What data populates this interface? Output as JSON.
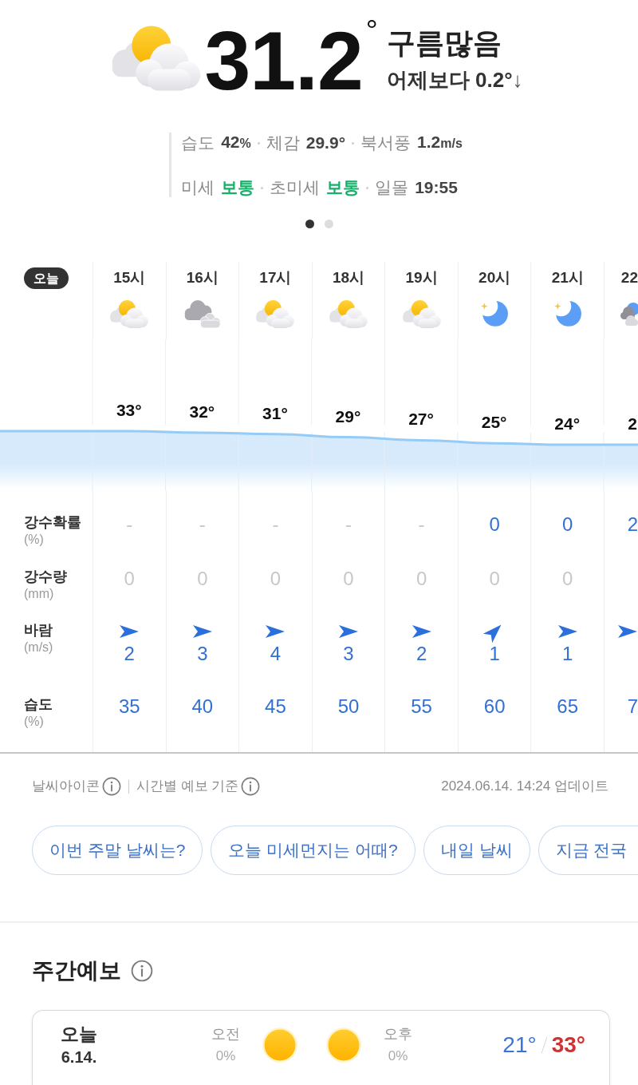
{
  "current": {
    "icon": {
      "kind": "partly_cloudy"
    },
    "temperature": "31.2$^{°}$",
    "condition": "구름많음",
    "yesterday_diff": "어제보다 0.2°",
    "trend_arrow": "↓",
    "details": [
      {
        "items": [
          {
            "label": "습도",
            "value": "42",
            "unit": "%",
            "color": "#444444"
          },
          {
            "label": "체감",
            "value": "29.9°",
            "color": "#444444"
          },
          {
            "label": "북서풍",
            "value": "1.2",
            "unit": "m/s",
            "color": "#444444"
          }
        ]
      },
      {
        "items": [
          {
            "label": "미세",
            "value": "보통",
            "color": "#17b06b"
          },
          {
            "label": "초미세",
            "value": "보통",
            "color": "#17b06b"
          },
          {
            "label": "일몰",
            "value": "19:55",
            "color": "#444444"
          }
        ]
      }
    ],
    "pages": [
      {
        "selected": true
      },
      {
        "selected": false
      }
    ]
  },
  "hourly": {
    "today_badge": "오늘",
    "hours": [
      {
        "time": "15시",
        "icon": {
          "kind": "partly_cloudy"
        },
        "temp": "33°"
      },
      {
        "time": "16시",
        "icon": {
          "kind": "cloudy"
        },
        "temp": "32°"
      },
      {
        "time": "17시",
        "icon": {
          "kind": "partly_cloudy"
        },
        "temp": "31°"
      },
      {
        "time": "18시",
        "icon": {
          "kind": "partly_cloudy"
        },
        "temp": "29°"
      },
      {
        "time": "19시",
        "icon": {
          "kind": "partly_cloudy"
        },
        "temp": "27°"
      },
      {
        "time": "20시",
        "icon": {
          "kind": "clear_night"
        },
        "temp": "25°"
      },
      {
        "time": "21시",
        "icon": {
          "kind": "clear_night"
        },
        "temp": "24°"
      },
      {
        "time": "22",
        "icon": {
          "kind": "cloud_moon"
        },
        "temp": "2"
      }
    ],
    "rows": [
      {
        "kind": "plain",
        "label": "강수확률",
        "unit": "(%)",
        "cells": [
          {
            "text": "-",
            "dimmed": true
          },
          {
            "text": "-",
            "dimmed": true
          },
          {
            "text": "-",
            "dimmed": true
          },
          {
            "text": "-",
            "dimmed": true
          },
          {
            "text": "-",
            "dimmed": true
          },
          {
            "text": "0",
            "dimmed": false
          },
          {
            "text": "0",
            "dimmed": false
          },
          {
            "text": "2",
            "dimmed": false
          }
        ]
      },
      {
        "kind": "plain",
        "label": "강수량",
        "unit": "(mm)",
        "cells": [
          {
            "text": "0",
            "dimmed": true
          },
          {
            "text": "0",
            "dimmed": true
          },
          {
            "text": "0",
            "dimmed": true
          },
          {
            "text": "0",
            "dimmed": true
          },
          {
            "text": "0",
            "dimmed": true
          },
          {
            "text": "0",
            "dimmed": true
          },
          {
            "text": "0",
            "dimmed": true
          }
        ]
      },
      {
        "kind": "wind",
        "label": "바람",
        "unit": "(m/s)",
        "cells": [
          {
            "text": "2",
            "kind": "east"
          },
          {
            "text": "3",
            "kind": "east"
          },
          {
            "text": "4",
            "kind": "east"
          },
          {
            "text": "3",
            "kind": "east"
          },
          {
            "text": "2",
            "kind": "east"
          },
          {
            "text": "1",
            "kind": "northeast"
          },
          {
            "text": "1",
            "kind": "east"
          },
          {
            "kind": "east"
          }
        ]
      },
      {
        "kind": "plain",
        "label": "습도",
        "unit": "(%)",
        "cells": [
          {
            "text": "35",
            "dimmed": false
          },
          {
            "text": "40",
            "dimmed": false
          },
          {
            "text": "45",
            "dimmed": false
          },
          {
            "text": "50",
            "dimmed": false
          },
          {
            "text": "55",
            "dimmed": false
          },
          {
            "text": "60",
            "dimmed": false
          },
          {
            "text": "65",
            "dimmed": false
          },
          {
            "text": "7",
            "dimmed": false
          }
        ]
      }
    ]
  },
  "footer": {
    "notes": [
      {
        "text": "날씨아이콘"
      },
      {
        "text": "시간별 예보 기준"
      }
    ],
    "updated": "2024.06.14. 14:24 업데이트"
  },
  "suggestions": [
    "이번 주말 날씨는?",
    "오늘 미세먼지는 어때?",
    "내일 날씨",
    "지금 전국"
  ],
  "weekly": {
    "title": "주간예보",
    "days": [
      {
        "day": "오늘",
        "date": "6.14.",
        "am": {
          "label": "오전",
          "rain": "0%",
          "icon": {
            "kind": "sunny"
          }
        },
        "pm": {
          "label": "오후",
          "rain": "0%",
          "icon": {
            "kind": "sunny"
          }
        },
        "low": "21°",
        "high": "33°"
      }
    ]
  }
}
